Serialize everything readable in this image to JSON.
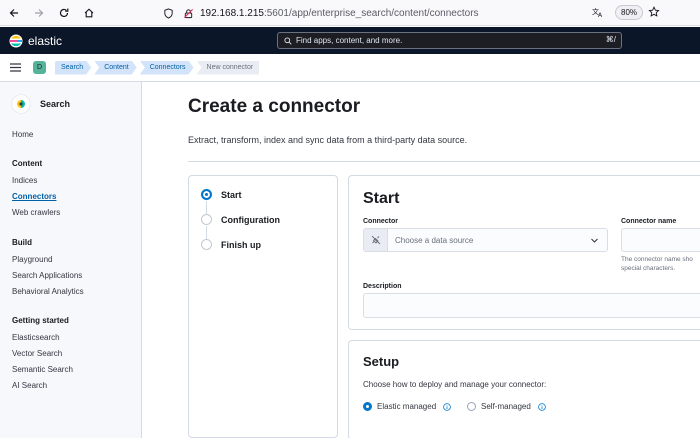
{
  "browser": {
    "url_host": "192.168.1.215",
    "url_rest": ":5601/app/enterprise_search/content/connectors",
    "zoom": "80%"
  },
  "header": {
    "brand": "elastic",
    "search_placeholder": "Find apps, content, and more.",
    "search_shortcut": "⌘/"
  },
  "breadcrumbs": {
    "space_initial": "D",
    "items": [
      "Search",
      "Content",
      "Connectors",
      "New connector"
    ]
  },
  "sidebar": {
    "title": "Search",
    "home": "Home",
    "sections": [
      {
        "heading": "Content",
        "items": [
          "Indices",
          "Connectors",
          "Web crawlers"
        ]
      },
      {
        "heading": "Build",
        "items": [
          "Playground",
          "Search Applications",
          "Behavioral Analytics"
        ]
      },
      {
        "heading": "Getting started",
        "items": [
          "Elasticsearch",
          "Vector Search",
          "Semantic Search",
          "AI Search"
        ]
      }
    ]
  },
  "main": {
    "title": "Create a connector",
    "description": "Extract, transform, index and sync data from a third-party data source.",
    "steps": [
      "Start",
      "Configuration",
      "Finish up"
    ],
    "start_card": {
      "title": "Start",
      "connector_label": "Connector",
      "connector_placeholder": "Choose a data source",
      "connector_name_label": "Connector name",
      "connector_name_help": "The connector name sho",
      "connector_name_help2": "special characters.",
      "description_label": "Description"
    },
    "setup_card": {
      "title": "Setup",
      "subtitle": "Choose how to deploy and manage your connector:",
      "options": [
        "Elastic managed",
        "Self-managed"
      ]
    }
  }
}
